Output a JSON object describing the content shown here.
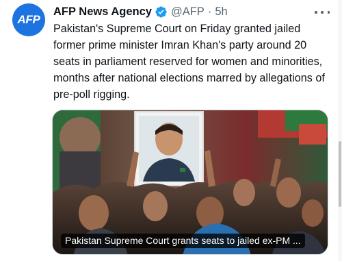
{
  "author": {
    "avatar_text": "AFP",
    "display_name": "AFP News Agency",
    "handle": "@AFP",
    "separator": "·",
    "time": "5h",
    "verified": true,
    "avatar_color": "#1d74e0",
    "verified_color": "#1d9bf0"
  },
  "tweet": {
    "text": "Pakistan's Supreme Court on Friday granted jailed former prime minister Imran Khan's party around 20 seats in parliament reserved for women and minorities, months after national elections marred by allegations of pre-poll rigging."
  },
  "media": {
    "link_caption": "Pakistan Supreme Court grants seats to jailed ex-PM ..."
  },
  "icons": {
    "more": "more-horizontal-icon",
    "verified": "verified-badge-icon"
  }
}
